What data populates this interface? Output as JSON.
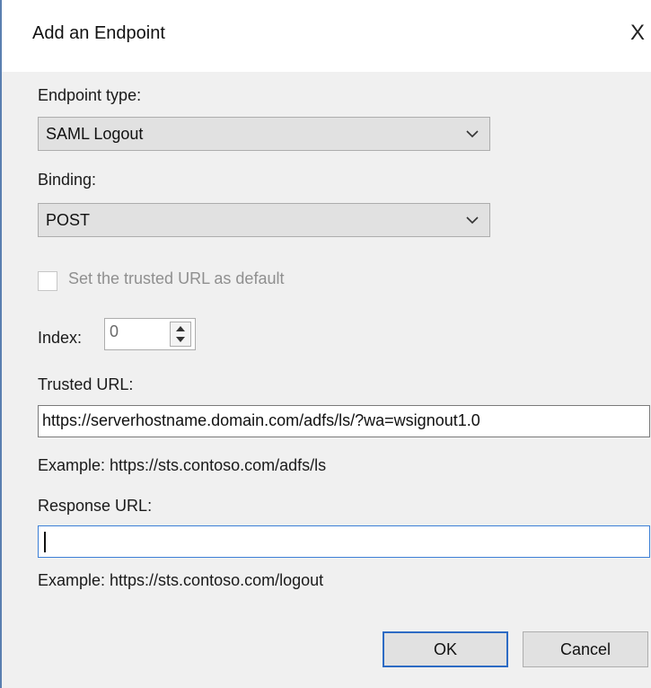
{
  "dialog": {
    "title": "Add an Endpoint",
    "close_glyph": "X"
  },
  "endpoint_type": {
    "label": "Endpoint type:",
    "selected": "SAML Logout"
  },
  "binding": {
    "label": "Binding:",
    "selected": "POST"
  },
  "default_checkbox": {
    "label": "Set the trusted URL as default",
    "checked": false,
    "enabled": false
  },
  "index": {
    "label": "Index:",
    "value": "0"
  },
  "trusted_url": {
    "label": "Trusted URL:",
    "value": "https://serverhostname.domain.com/adfs/ls/?wa=wsignout1.0",
    "example": "Example: https://sts.contoso.com/adfs/ls"
  },
  "response_url": {
    "label": "Response URL:",
    "value": "",
    "example": "Example: https://sts.contoso.com/logout"
  },
  "buttons": {
    "ok": "OK",
    "cancel": "Cancel"
  },
  "icons": {
    "dropdown": "chevron-down-icon",
    "stepper": "spin-arrows-icon",
    "close": "close-icon"
  },
  "colors": {
    "dialog_bg": "#f0f0f0",
    "title_bg": "#ffffff",
    "focus_border": "#3c7fd6",
    "default_button_border": "#2d6bc4",
    "disabled_text": "#8f8f8f"
  }
}
